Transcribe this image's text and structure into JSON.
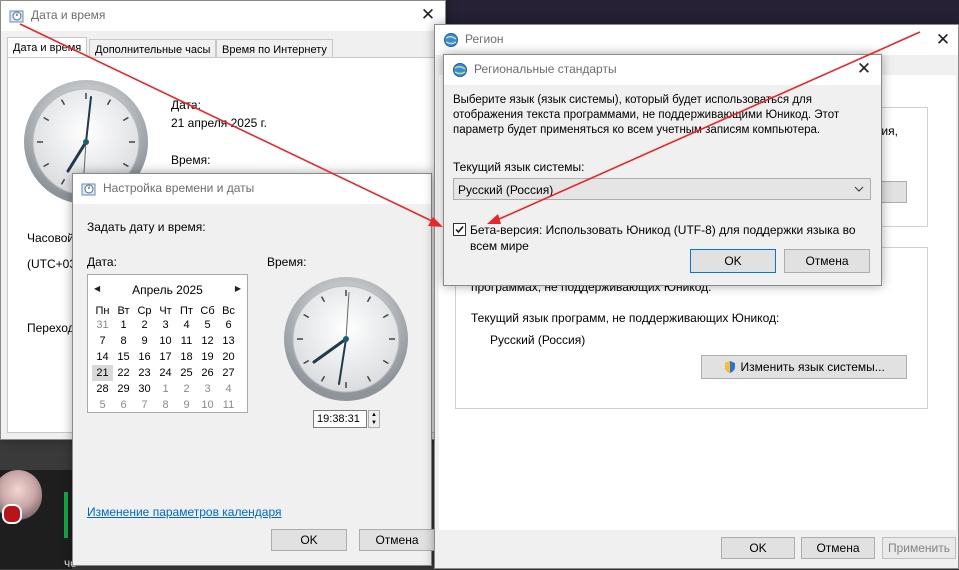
{
  "date_time_window": {
    "title": "Дата и время",
    "tabs": [
      "Дата и время",
      "Дополнительные часы",
      "Время по Интернету"
    ],
    "date_label": "Дата:",
    "date_value": "21 апреля 2025 г.",
    "time_label": "Время:",
    "timezone_label": "Часовой",
    "timezone_value": "(UTC+03",
    "transition_label": "Переход"
  },
  "set_time_dialog": {
    "title": "Настройка времени и даты",
    "instruction": "Задать дату и время:",
    "date_label": "Дата:",
    "time_label": "Время:",
    "month_title": "Апрель 2025",
    "prev_arrow": "◀",
    "next_arrow": "▶",
    "weekdays": [
      "Пн",
      "Вт",
      "Ср",
      "Чт",
      "Пт",
      "Сб",
      "Вс"
    ],
    "weeks": [
      [
        "31",
        "1",
        "2",
        "3",
        "4",
        "5",
        "6"
      ],
      [
        "7",
        "8",
        "9",
        "10",
        "11",
        "12",
        "13"
      ],
      [
        "14",
        "15",
        "16",
        "17",
        "18",
        "19",
        "20"
      ],
      [
        "21",
        "22",
        "23",
        "24",
        "25",
        "26",
        "27"
      ],
      [
        "28",
        "29",
        "30",
        "1",
        "2",
        "3",
        "4"
      ],
      [
        "5",
        "6",
        "7",
        "8",
        "9",
        "10",
        "11"
      ]
    ],
    "selected_day": "21",
    "time_hours": "19",
    "time_minutes": "38",
    "time_seconds": "31",
    "calendar_link": "Изменение параметров календаря",
    "ok_label": "OK",
    "cancel_label": "Отмена"
  },
  "region_window": {
    "title": "Регион",
    "partial_text_1": "вия,",
    "partial_text_2": "программах, не поддерживающих Юникод.",
    "current_lang_label": "Текущий язык программ, не поддерживающих Юникод:",
    "current_lang_value": "Русский (Россия)",
    "change_button": "Изменить язык системы...",
    "ok_label": "OK",
    "cancel_label": "Отмена",
    "apply_label": "Применить"
  },
  "regional_dialog": {
    "title": "Региональные стандарты",
    "description_line1": "Выберите язык (язык системы), который будет использоваться для",
    "description_line2": "отображения текста программами, не поддерживающими Юникод. Этот",
    "description_line3": "параметр будет применяться ко всем учетным записям компьютера.",
    "current_lang_label": "Текущий язык системы:",
    "dropdown_value": "Русский (Россия)",
    "checkbox_checked": true,
    "beta_line1": "Бета-версия: Использовать Юникод (UTF-8) для поддержки языка во",
    "beta_line2": "всем мире",
    "ok_label": "OK",
    "cancel_label": "Отмена"
  },
  "taskbar_fragment": {
    "text": "чо"
  },
  "colors": {
    "arrow": "#e8262c",
    "link": "#0066cc",
    "accent": "#0078d7",
    "dark_bg": "#252040"
  }
}
